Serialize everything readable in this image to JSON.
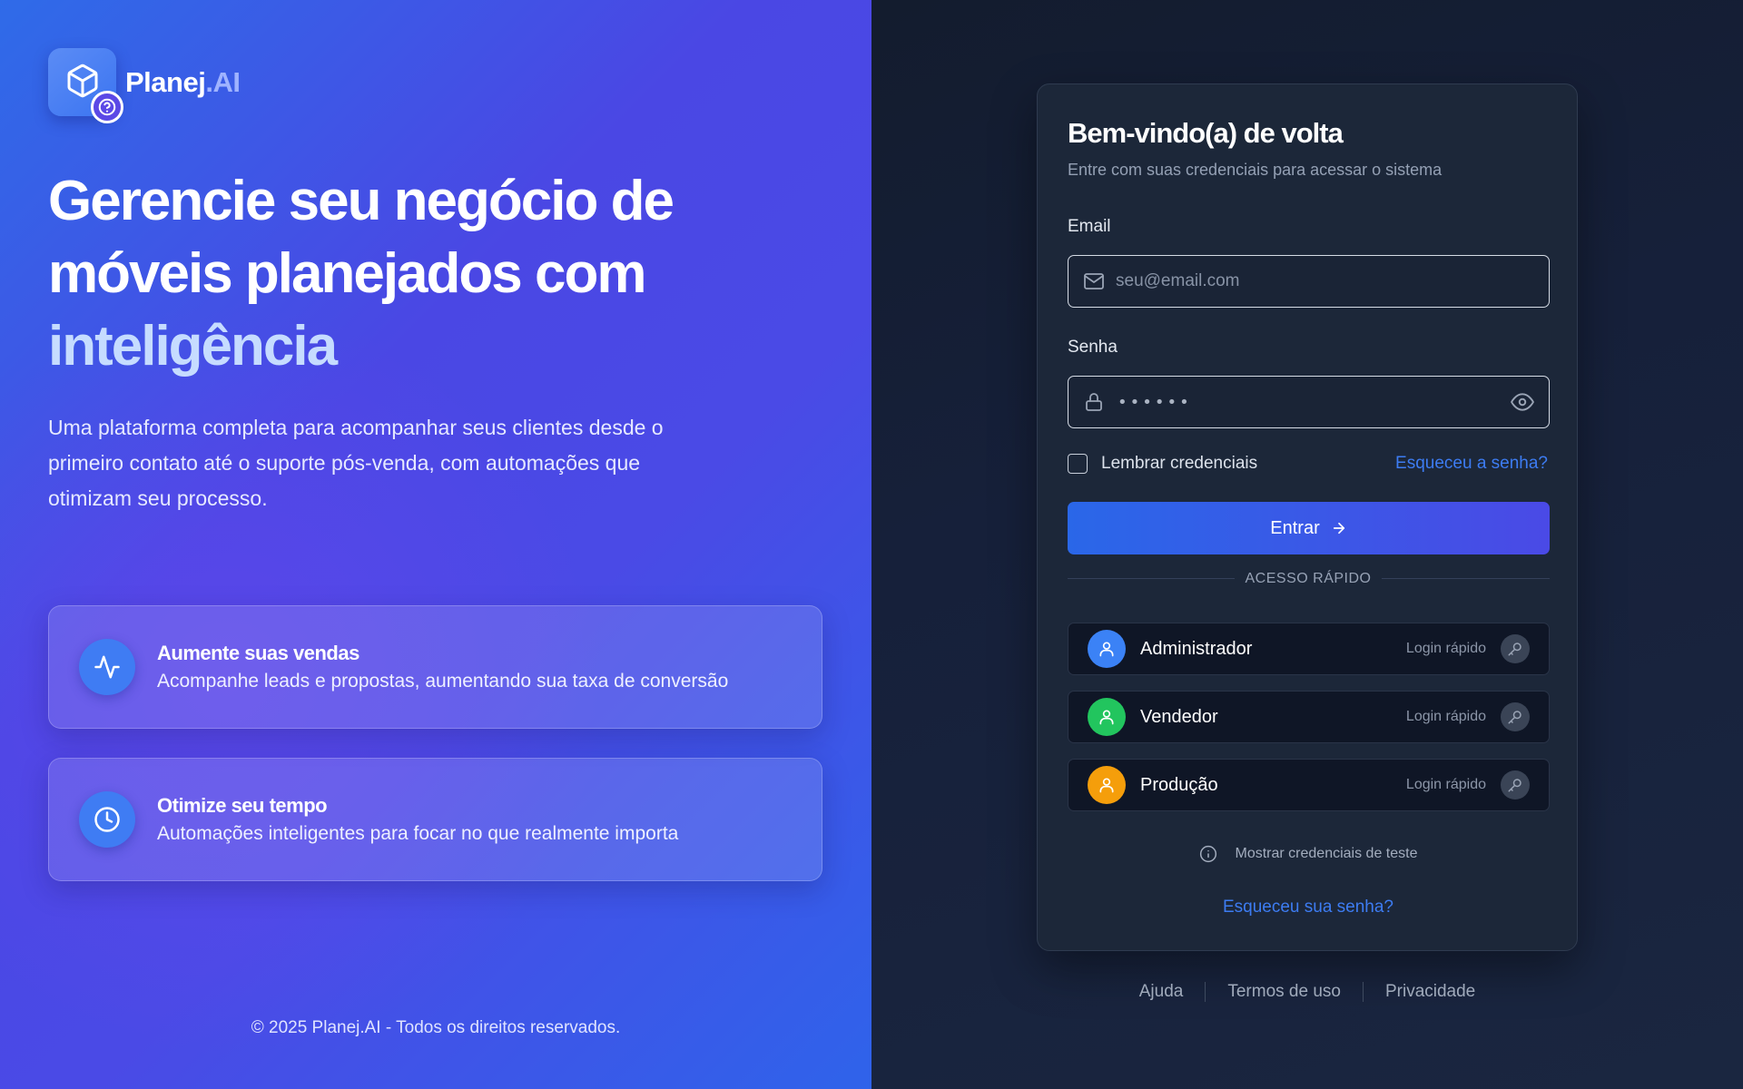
{
  "brand": {
    "name": "Planej",
    "suffix": ".AI"
  },
  "hero": {
    "headline_line1": "Gerencie seu negócio de",
    "headline_line2": "móveis planejados com",
    "headline_highlight": "inteligência",
    "subtitle": "Uma plataforma completa para acompanhar seus clientes desde o primeiro contato até o suporte pós-venda, com automações que otimizam seu processo."
  },
  "features": [
    {
      "icon": "activity-icon",
      "title": "Aumente suas vendas",
      "description": "Acompanhe leads e propostas, aumentando sua taxa de conversão"
    },
    {
      "icon": "clock-icon",
      "title": "Otimize seu tempo",
      "description": "Automações inteligentes para focar no que realmente importa"
    }
  ],
  "copyright": "© 2025 Planej.AI - Todos os direitos reservados.",
  "login": {
    "title": "Bem-vindo(a) de volta",
    "subtitle": "Entre com suas credenciais para acessar o sistema",
    "email_label": "Email",
    "email_placeholder": "seu@email.com",
    "email_value": "",
    "password_label": "Senha",
    "password_value": "••••••",
    "remember_label": "Lembrar credenciais",
    "remember_checked": false,
    "forgot_inline": "Esqueceu a senha?",
    "submit_label": "Entrar",
    "quick_access_label": "ACESSO RÁPIDO",
    "quick_users": [
      {
        "name": "Administrador",
        "hint": "Login rápido",
        "color": "#3b82f6"
      },
      {
        "name": "Vendedor",
        "hint": "Login rápido",
        "color": "#22c55e"
      },
      {
        "name": "Produção",
        "hint": "Login rápido",
        "color": "#f59e0b"
      }
    ],
    "show_credentials": "Mostrar credenciais de teste",
    "forgot_bottom": "Esqueceu sua senha?"
  },
  "footer_links": [
    "Ajuda",
    "Termos de uso",
    "Privacidade"
  ],
  "colors": {
    "accent": "#3d7cf2",
    "left_gradient_start": "#2f6be8",
    "left_gradient_mid": "#4a47e4",
    "card_bg": "#1c2739"
  }
}
